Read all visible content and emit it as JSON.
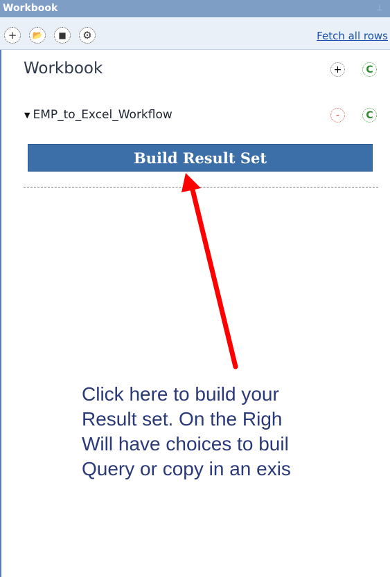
{
  "panel": {
    "title": "Workbook",
    "pin_icon": "pin-icon"
  },
  "toolbar": {
    "buttons": [
      {
        "name": "add-icon",
        "glyph": "+"
      },
      {
        "name": "open-folder-icon",
        "glyph": "📂"
      },
      {
        "name": "save-disk-icon",
        "glyph": "■"
      },
      {
        "name": "settings-gear-icon",
        "glyph": "⚙"
      }
    ],
    "fetch_label": "Fetch all rows"
  },
  "workbook": {
    "heading": "Workbook",
    "add_glyph": "+",
    "refresh_glyph": "C"
  },
  "tree": {
    "item_label": "EMP_to_Excel_Workflow",
    "remove_glyph": "-",
    "refresh_glyph": "C"
  },
  "actions": {
    "build_label": "Build Result Set"
  },
  "annotation": {
    "lines": [
      "Click here to build your",
      "Result set.  On the Righ",
      "Will have choices to buil",
      "Query or copy in an exis"
    ],
    "arrow_color": "#ff0000"
  },
  "colors": {
    "titlebar": "#7f9ec6",
    "toolbar": "#e9f0f7",
    "button": "#3c6fa8"
  }
}
